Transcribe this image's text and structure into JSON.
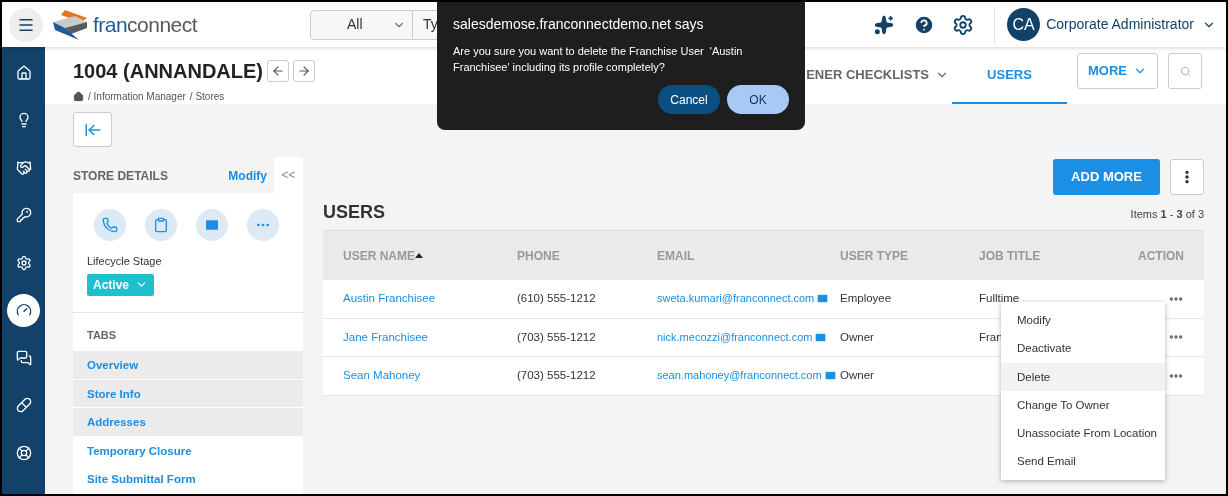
{
  "header": {
    "logo_part1": "fran",
    "logo_part2": "connect",
    "search_scope": "All",
    "search_partial": "Ty",
    "avatar": "CA",
    "user_name": "Corporate Administrator"
  },
  "sidebar": {
    "items": [
      {
        "selected": false
      },
      {
        "selected": false
      },
      {
        "selected": false
      },
      {
        "selected": false
      },
      {
        "selected": false
      },
      {
        "selected": true
      },
      {
        "selected": false
      },
      {
        "selected": false
      },
      {
        "selected": false
      }
    ]
  },
  "page": {
    "title": "1004 (ANNANDALE)",
    "breadcrumb": [
      "/ Information Manager",
      "/ Stores"
    ]
  },
  "tabs": [
    {
      "label": "ENER CHECKLISTS",
      "selected": false,
      "dropdown": true
    },
    {
      "label": "USERS",
      "selected": true,
      "dropdown": false
    }
  ],
  "more_button": "MORE",
  "store_details": {
    "title": "STORE DETAILS",
    "modify": "Modify",
    "collapse": "<<",
    "lifecycle_label": "Lifecycle Stage",
    "lifecycle_value": "Active",
    "tabs_title": "TABS",
    "tabs": [
      {
        "label": "Overview",
        "highlighted": true
      },
      {
        "label": "Store Info",
        "highlighted": true
      },
      {
        "label": "Addresses",
        "highlighted": true
      },
      {
        "label": "Temporary Closure",
        "highlighted": false
      },
      {
        "label": "Site Submittal Form",
        "highlighted": false
      }
    ]
  },
  "users": {
    "title": "USERS",
    "add_button": "ADD MORE",
    "items_count": "Items **1** - **3** of 3",
    "columns": [
      {
        "label": "USER NAME",
        "sorted": true
      },
      {
        "label": "PHONE",
        "sorted": false
      },
      {
        "label": "EMAIL",
        "sorted": false
      },
      {
        "label": "USER TYPE",
        "sorted": false
      },
      {
        "label": "JOB TITLE",
        "sorted": false
      },
      {
        "label": "ACTION",
        "sorted": false
      }
    ],
    "rows": [
      {
        "name": "Austin Franchisee",
        "phone": "(610) 555-1212",
        "email": "sweta.kumari@franconnect.com",
        "user_type": "Employee",
        "job_title": "Fulltime"
      },
      {
        "name": "Jane Franchisee",
        "phone": "(703) 555-1212",
        "email": "nick.mecozzi@franconnect.com",
        "user_type": "Owner",
        "job_title": "Fran"
      },
      {
        "name": "Sean Mahoney",
        "phone": "(703) 555-1212",
        "email": "sean.mahoney@franconnect.com",
        "user_type": "Owner"
      }
    ]
  },
  "action_menu": [
    {
      "label": "Modify",
      "selected": false
    },
    {
      "label": "Deactivate",
      "selected": false
    },
    {
      "label": "Delete",
      "selected": true
    },
    {
      "label": "Change To Owner",
      "selected": false
    },
    {
      "label": "Unassociate From Location",
      "selected": false
    },
    {
      "label": "Send Email",
      "selected": false
    }
  ],
  "dialog": {
    "title": "salesdemose.franconnectdemo.net says",
    "message": "Are you sure you want to delete the Franchise User  'Austin Franchisee' including its profile completely?",
    "buttons": [
      {
        "label": "Cancel",
        "kind": "secondary"
      },
      {
        "label": "OK",
        "kind": "primary"
      }
    ]
  }
}
